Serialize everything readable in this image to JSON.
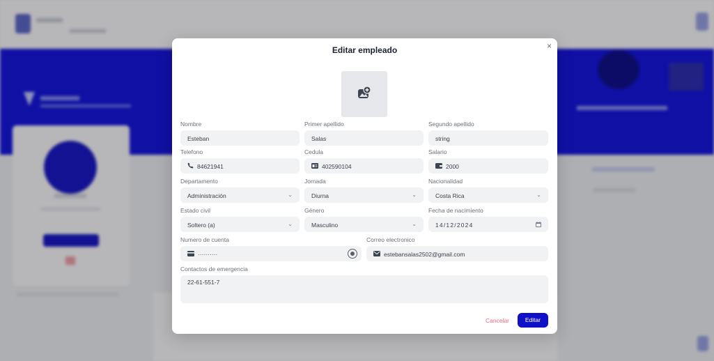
{
  "modal": {
    "title": "Editar empleado",
    "close_glyph": "×",
    "photo_icon": "add-image-icon",
    "fields": {
      "nombre": {
        "label": "Nombre",
        "value": "Esteban"
      },
      "primer_apellido": {
        "label": "Primer apellido",
        "value": "Salas"
      },
      "segundo_apellido": {
        "label": "Segundo apellido",
        "value": "string"
      },
      "telefono": {
        "label": "Telefono",
        "value": "84621941",
        "icon": "phone-icon"
      },
      "cedula": {
        "label": "Cedula",
        "value": "402590104",
        "icon": "id-card-icon"
      },
      "salario": {
        "label": "Salario",
        "value": "2000",
        "icon": "wallet-icon"
      },
      "departamento": {
        "label": "Departamento",
        "value": "Administración"
      },
      "jornada": {
        "label": "Jornada",
        "value": "Diurna"
      },
      "nacionalidad": {
        "label": "Nacionalidad",
        "value": "Costa Rica"
      },
      "estado_civil": {
        "label": "Estado civil",
        "value": "Soltero (a)"
      },
      "genero": {
        "label": "Género",
        "value": "Masculino"
      },
      "fecha_nacimiento": {
        "label": "Fecha de nacimiento",
        "value": "14/12/2024",
        "icon": "calendar-icon"
      },
      "numero_cuenta": {
        "label": "Numero de cuenta",
        "value": "··········",
        "icon": "credit-card-icon"
      },
      "correo": {
        "label": "Correo electronico",
        "value": "estebansalas2502@gmail.com",
        "icon": "mail-icon"
      },
      "contactos": {
        "label": "Contactos de emergencia",
        "value": "22-61-551-7"
      }
    },
    "cancel_label": "Cancelar",
    "edit_label": "Editar"
  },
  "colors": {
    "primary": "#1010c8",
    "background_blue": "#1010e3",
    "cancel": "#f06b7e",
    "field_bg": "#f1f2f4"
  }
}
